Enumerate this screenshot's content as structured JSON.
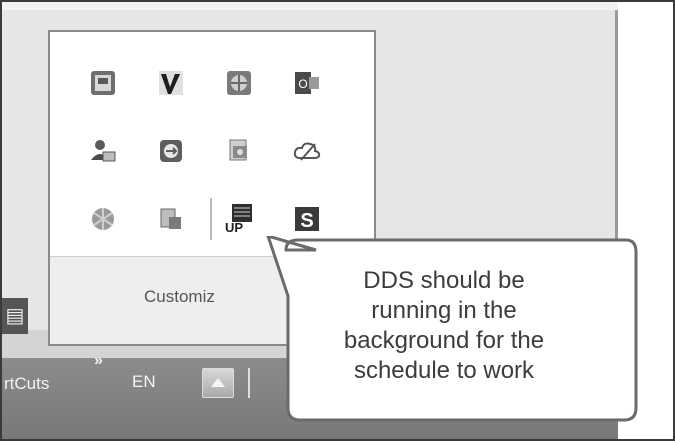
{
  "popup": {
    "icons": [
      {
        "name": "photo-viewer-icon"
      },
      {
        "name": "v-app-icon"
      },
      {
        "name": "globe-window-icon"
      },
      {
        "name": "outlook-icon"
      },
      {
        "name": "user-monitor-icon"
      },
      {
        "name": "teamviewer-icon"
      },
      {
        "name": "printer-app-icon"
      },
      {
        "name": "cloud-sync-icon"
      },
      {
        "name": "shield-icon"
      },
      {
        "name": "disk-utility-icon"
      },
      {
        "name": "dds-up-icon"
      },
      {
        "name": "s-app-icon"
      }
    ],
    "customize_label": "Customiz"
  },
  "taskbar": {
    "shortcuts_label": "rtCuts",
    "chevron": "»",
    "language": "EN"
  },
  "callout": {
    "text_line1": "DDS should be",
    "text_line2": "running in the",
    "text_line3": "background for the",
    "text_line4": "schedule to work"
  },
  "colors": {
    "taskbar": "#808080",
    "popup_bg": "#ffffff",
    "callout_border": "#6b6b6b"
  }
}
